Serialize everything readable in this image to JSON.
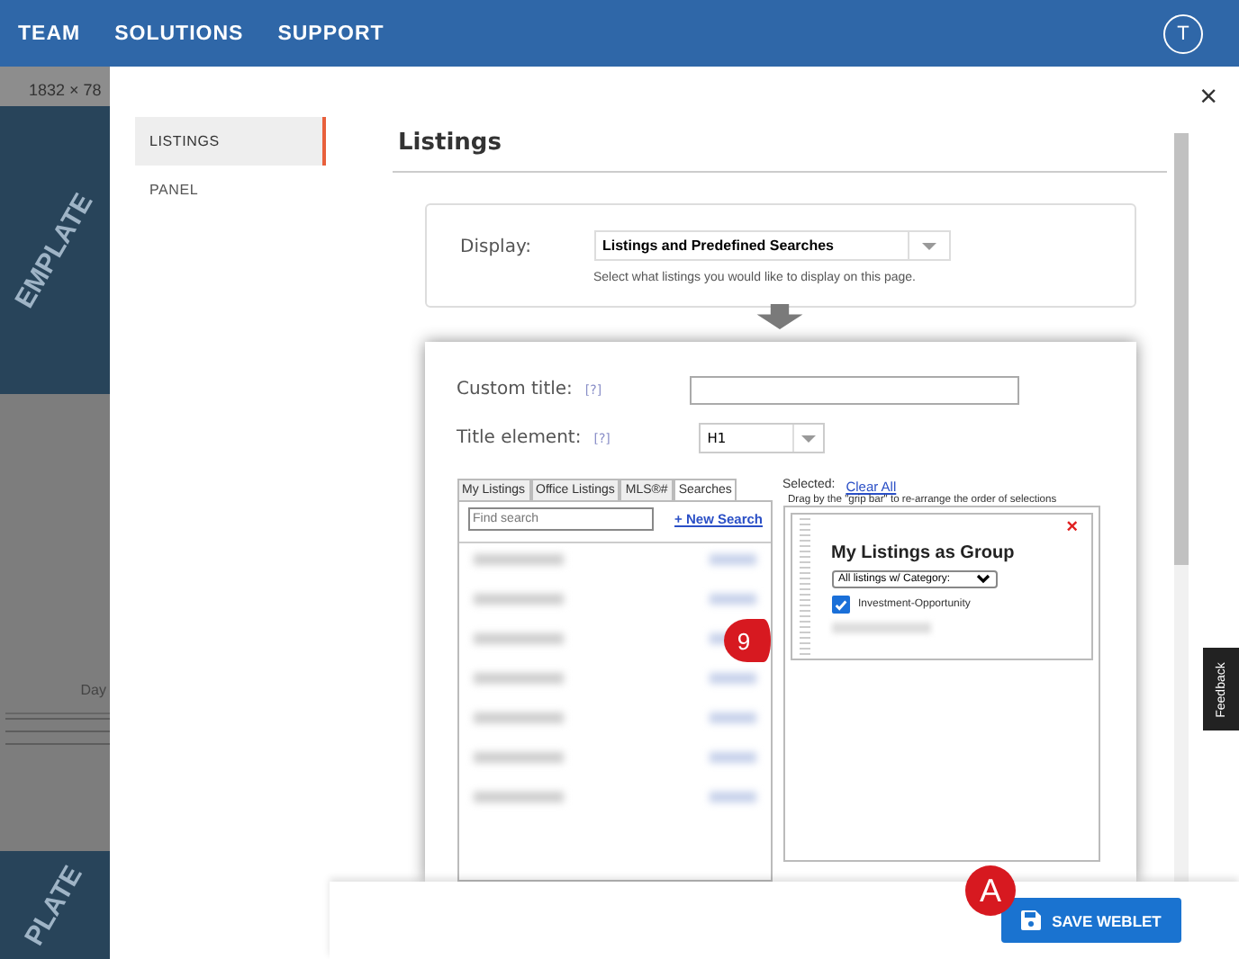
{
  "nav": {
    "items": [
      "TEAM",
      "SOLUTIONS",
      "SUPPORT"
    ],
    "avatar": "T"
  },
  "background_page": {
    "dimensions": "1832 × 78",
    "watermark_top": "EMPLATE",
    "watermark_bottom": "PLATE",
    "label": "Day"
  },
  "modal": {
    "close": "×",
    "sidebar": {
      "items": [
        {
          "label": "LISTINGS",
          "selected": true
        },
        {
          "label": "PANEL",
          "selected": false
        }
      ]
    },
    "heading": "Listings",
    "display": {
      "label": "Display:",
      "value": "Listings and Predefined Searches",
      "help": "Select what listings you would like to display on this page."
    },
    "embedded": {
      "custom_title": {
        "label": "Custom title:",
        "help": "[?]"
      },
      "title_element": {
        "label": "Title element:",
        "help": "[?]",
        "value": "H1"
      },
      "tabs": [
        {
          "label": "My Listings",
          "selected": false
        },
        {
          "label": "Office Listings",
          "selected": false
        },
        {
          "label": "MLS®#",
          "selected": false
        },
        {
          "label": "Searches",
          "selected": true
        }
      ],
      "search": {
        "placeholder": "Find search"
      },
      "new_search": "+ New Search",
      "selected_label": "Selected:",
      "clear_all": "Clear All",
      "drag_hint": "Drag by the \"grip bar\" to re-arrange the order of selections",
      "group": {
        "title": "My Listings as Group",
        "remove": "×",
        "filter": "All listings w/ Category:",
        "categories": [
          {
            "label": "Investment-Opportunity",
            "checked": true
          }
        ]
      }
    },
    "save_button": "SAVE WEBLET"
  },
  "annotations": [
    {
      "label": "9",
      "kind": "callout"
    },
    {
      "label": "A",
      "kind": "circle"
    }
  ],
  "feedback_tab": "Feedback"
}
